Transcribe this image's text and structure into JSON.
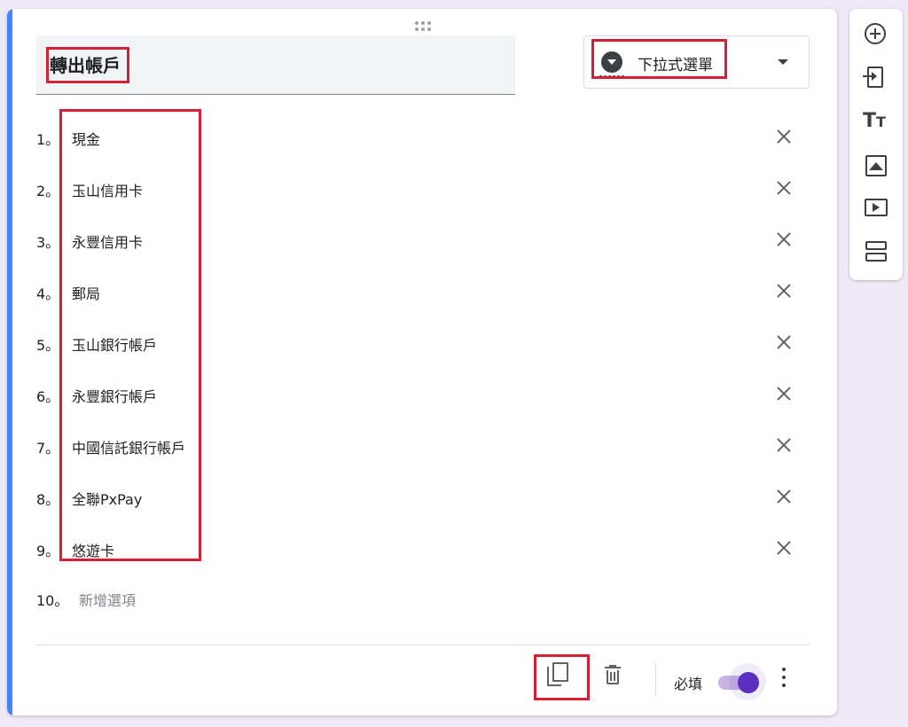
{
  "question": {
    "title": "轉出帳戶",
    "type_label": "下拉式選單",
    "type_icon": "dropdown-circle-icon"
  },
  "options": [
    {
      "number": "1。",
      "label": "現金"
    },
    {
      "number": "2。",
      "label": "玉山信用卡"
    },
    {
      "number": "3。",
      "label": "永豐信用卡"
    },
    {
      "number": "4。",
      "label": "郵局"
    },
    {
      "number": "5。",
      "label": "玉山銀行帳戶"
    },
    {
      "number": "6。",
      "label": "永豐銀行帳戶"
    },
    {
      "number": "7。",
      "label": "中國信託銀行帳戶"
    },
    {
      "number": "8。",
      "label": "全聯PxPay"
    },
    {
      "number": "9。",
      "label": "悠遊卡"
    }
  ],
  "add_option": {
    "number": "10。",
    "label": "新增選項"
  },
  "footer": {
    "required_label": "必填",
    "required_on": true
  },
  "toolbar": {
    "text_icon_big": "T",
    "text_icon_small": "T"
  },
  "colors": {
    "accent": "#4285f4",
    "highlight": "#d32035",
    "toggle": "#5d2fc1"
  }
}
